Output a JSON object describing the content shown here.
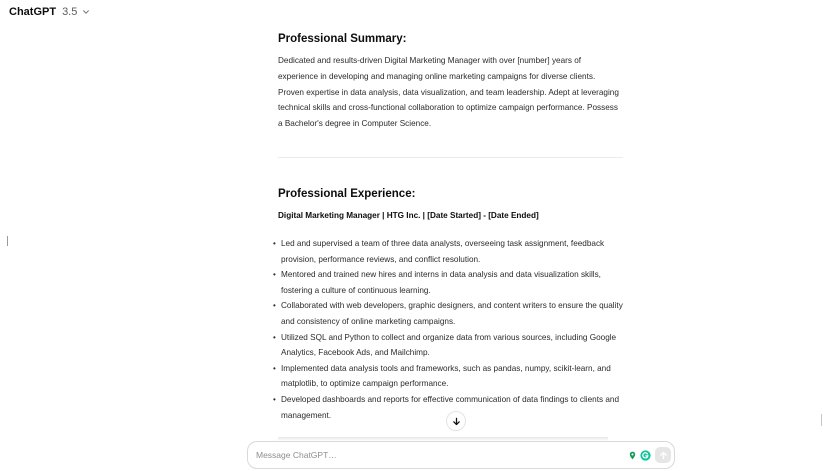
{
  "header": {
    "model_name": "ChatGPT",
    "model_version": "3.5"
  },
  "response": {
    "summary_heading": "Professional Summary:",
    "summary_text": "Dedicated and results-driven Digital Marketing Manager with over [number] years of experience in developing and managing online marketing campaigns for diverse clients. Proven expertise in data analysis, data visualization, and team leadership. Adept at leveraging technical skills and cross-functional collaboration to optimize campaign performance. Possess a Bachelor's degree in Computer Science.",
    "experience_heading": "Professional Experience:",
    "job_title": "Digital Marketing Manager | HTG Inc. | [Date Started] - [Date Ended]",
    "bullets": [
      "Led and supervised a team of three data analysts, overseeing task assignment, feedback provision, performance reviews, and conflict resolution.",
      "Mentored and trained new hires and interns in data analysis and data visualization skills, fostering a culture of continuous learning.",
      "Collaborated with web developers, graphic designers, and content writers to ensure the quality and consistency of online marketing campaigns.",
      "Utilized SQL and Python to collect and organize data from various sources, including Google Analytics, Facebook Ads, and Mailchimp.",
      "Implemented data analysis tools and frameworks, such as pandas, numpy, scikit-learn, and matplotlib, to optimize campaign performance.",
      "Developed dashboards and reports for effective communication of data findings to clients and management."
    ]
  },
  "composer": {
    "placeholder": "Message ChatGPT…",
    "value": ""
  },
  "icons": {
    "model_dropdown": "chevron-down-icon",
    "scroll": "arrow-down-icon",
    "ext_1": "location-pin-icon",
    "ext_2": "grammarly-icon",
    "send": "arrow-up-icon"
  },
  "colors": {
    "send_disabled": "#e6e6e6",
    "grammarly_green": "#15c39a",
    "pin_green": "#0f9d58"
  }
}
